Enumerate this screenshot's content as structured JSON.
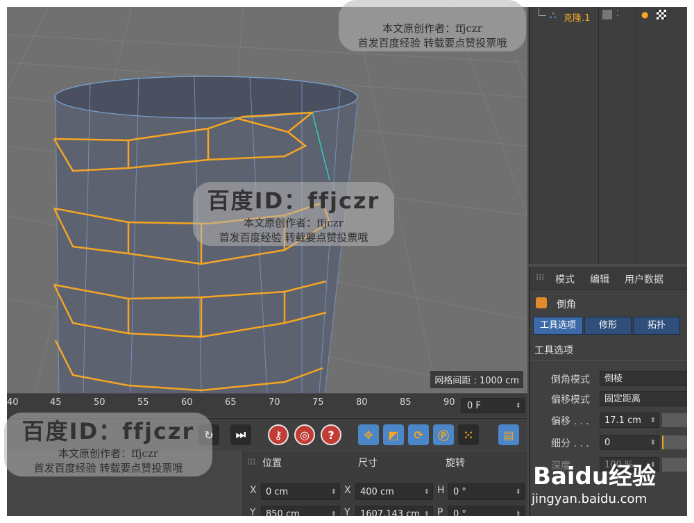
{
  "object_manager": {
    "object_name": "克隆.1"
  },
  "viewport": {
    "grid_spacing_label": "网格间距 : 1000 cm"
  },
  "attributes": {
    "tabs": [
      "模式",
      "编辑",
      "用户数据"
    ],
    "object_type": "倒角",
    "tool_tabs": [
      "工具选项",
      "修形",
      "拓扑"
    ],
    "section_title": "工具选项",
    "properties": [
      {
        "label": "倒角模式",
        "value": "倒棱"
      },
      {
        "label": "偏移模式",
        "value": "固定距离"
      },
      {
        "label": "偏移 . . .",
        "value": "17.1 cm"
      },
      {
        "label": "细分 . . .",
        "value": "0"
      },
      {
        "label": "深度",
        "value": "100 %"
      }
    ]
  },
  "timeline": {
    "ticks": [
      "40",
      "45",
      "50",
      "55",
      "60",
      "65",
      "70",
      "75",
      "80",
      "85",
      "90"
    ],
    "current_frame": "0 F"
  },
  "coordinates": {
    "headers": [
      "位置",
      "尺寸",
      "旋转"
    ],
    "rows": [
      {
        "pos_axis": "X",
        "pos_value": "0 cm",
        "size_axis": "X",
        "size_value": "400 cm",
        "rot_axis": "H",
        "rot_value": "0 °"
      },
      {
        "pos_axis": "Y",
        "pos_value": "850 cm",
        "size_axis": "Y",
        "size_value": "1607.143 cm",
        "rot_axis": "P",
        "rot_value": "0 °"
      }
    ]
  },
  "watermarks": {
    "id_text": "百度ID：ffjczr",
    "line1": "本文原创作者：ffjczr",
    "line2": "首发百度经验 转载要点赞投票哦",
    "baidu_logo": "Baidu经验",
    "baidu_url": "jingyan.baidu.com"
  },
  "colors": {
    "selection": "#f5a623",
    "accent_blue": "#3c6aa8",
    "object_name": "#f2a92a"
  }
}
